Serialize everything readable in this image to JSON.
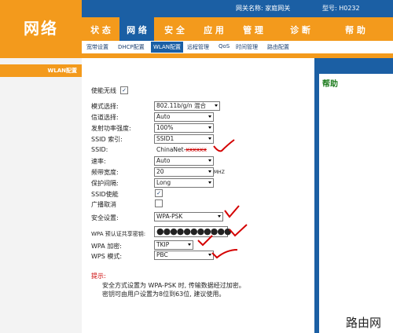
{
  "logo": "网络",
  "header": {
    "gateway": "网关名称: 家庭网关",
    "model": "型号: H0232"
  },
  "nav": [
    {
      "label": "状 态"
    },
    {
      "label": "网 络"
    },
    {
      "label": "安 全"
    },
    {
      "label": "应 用"
    },
    {
      "label": "管 理"
    },
    {
      "label": "诊 断"
    },
    {
      "label": "帮 助"
    }
  ],
  "subnav": [
    {
      "label": "宽带设置"
    },
    {
      "label": "DHCP配置"
    },
    {
      "label": "WLAN配置"
    },
    {
      "label": "远程管理"
    },
    {
      "label": "QoS"
    },
    {
      "label": "时间管理"
    },
    {
      "label": "路由配置"
    }
  ],
  "sidebar": {
    "item": "WLAN配置"
  },
  "help": {
    "title": "帮助"
  },
  "form": {
    "enable_label": "使能无线",
    "enable_checked": "✓",
    "mode_label": "模式选择:",
    "mode_value": "802.11b/g/n 混合",
    "channel_label": "信道选择:",
    "channel_value": "Auto",
    "power_label": "发射功率强度:",
    "power_value": "100%",
    "ssid_index_label": "SSID 索引:",
    "ssid_index_value": "SSID1",
    "ssid_label": "SSID:",
    "ssid_value": "ChinaNet-",
    "ssid_value_struck": "xxxxxx",
    "rate_label": "速率:",
    "rate_value": "Auto",
    "bandwidth_label": "频带宽度:",
    "bandwidth_value": "20",
    "bandwidth_unit": "MHZ",
    "guard_label": "保护间隔:",
    "guard_value": "Long",
    "ssid_enable_label": "SSID使能",
    "ssid_enable_checked": "✓",
    "broadcast_label": "广播取消",
    "security_label": "安全设置:",
    "security_value": "WPA-PSK",
    "wpa_key_label": "WPA 预认证共享密钥:",
    "wpa_key_value": "●●●●●●●●●●●",
    "wpa_enc_label": "WPA 加密:",
    "wpa_enc_value": "TKIP",
    "wps_label": "WPS 模式:",
    "wps_value": "PBC"
  },
  "tip": {
    "title": "提示:",
    "line1": "安全方式设置为 WPA-PSK 时, 传输数据经过加密。",
    "line2": "密钥可由用户设置为8位到63位, 建议使用。"
  },
  "watermark": "路由网",
  "colors": {
    "orange": "#f39a1c",
    "blue": "#1b5fa4",
    "annotation": "#d40000"
  }
}
